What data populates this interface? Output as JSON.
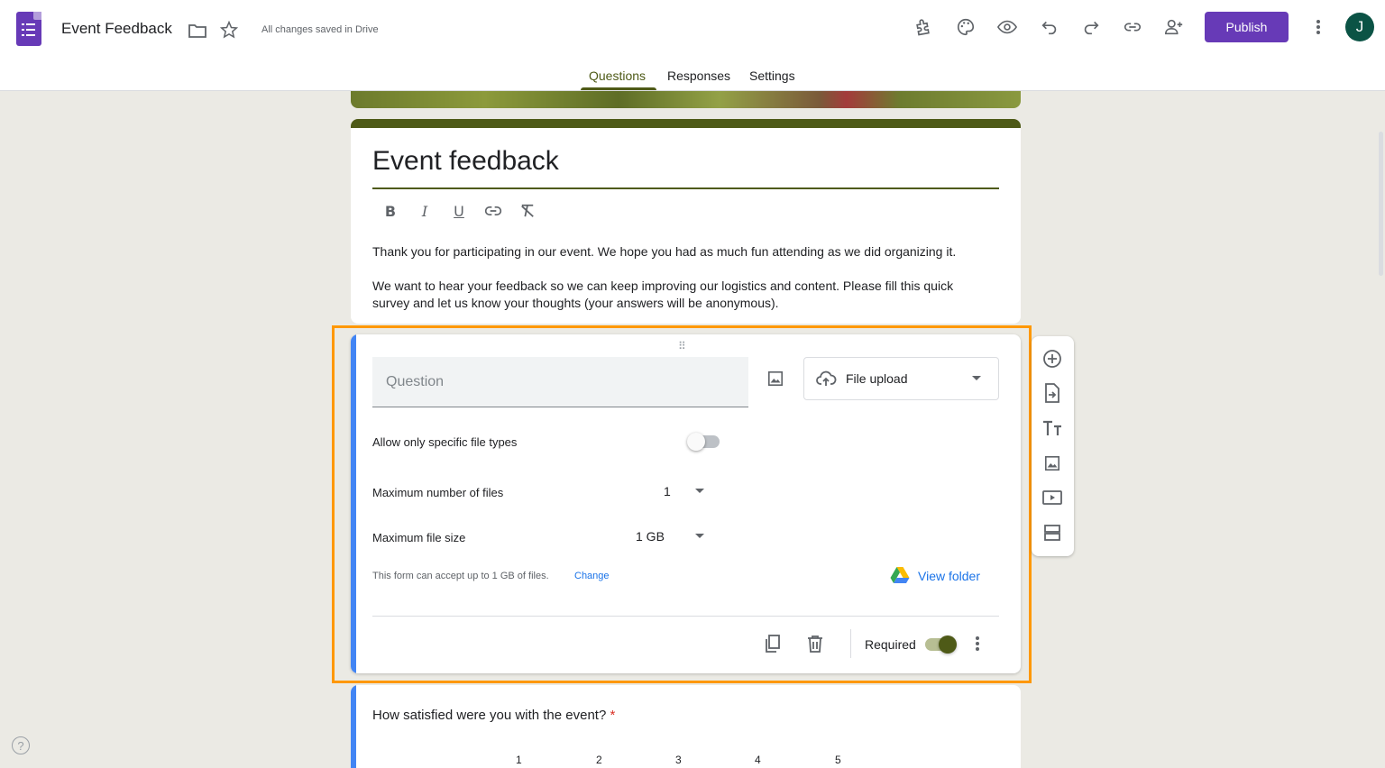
{
  "header": {
    "doc_title": "Event Feedback",
    "saved_status": "All changes saved in Drive",
    "publish_label": "Publish",
    "avatar_initial": "J",
    "icons": [
      "folder-icon",
      "star-icon",
      "addon-icon",
      "palette-icon",
      "preview-icon",
      "undo-icon",
      "redo-icon",
      "link-icon",
      "add-collaborator-icon",
      "more-vert-icon"
    ]
  },
  "tabs": [
    {
      "label": "Questions",
      "active": true
    },
    {
      "label": "Responses",
      "active": false
    },
    {
      "label": "Settings",
      "active": false
    }
  ],
  "form": {
    "title": "Event feedback",
    "description_1": "Thank you for participating in our event. We hope you had as much fun attending as we did organizing it.",
    "description_2": "We want to hear your feedback so we can keep improving our logistics and content. Please fill this quick survey and let us know your thoughts (your answers will be anonymous).",
    "format_tools": [
      "bold",
      "italic",
      "underline",
      "link",
      "clear-formatting"
    ]
  },
  "question_card": {
    "placeholder": "Question",
    "type_label": "File upload",
    "allow_specific_types_label": "Allow only specific file types",
    "allow_specific_types_on": false,
    "max_files_label": "Maximum number of files",
    "max_files_value": "1",
    "max_size_label": "Maximum file size",
    "max_size_value": "1 GB",
    "note": "This form can accept up to 1 GB of files.",
    "note_link": "Change",
    "view_folder": "View folder",
    "required_label": "Required",
    "required_on": true
  },
  "side_toolbar": [
    "add-question-icon",
    "import-questions-icon",
    "add-title-icon",
    "add-image-icon",
    "add-video-icon",
    "add-section-icon"
  ],
  "next_question": {
    "title": "How satisfied were you with the event?",
    "required_mark": "*",
    "scale": [
      "1",
      "2",
      "3",
      "4",
      "5"
    ]
  },
  "colors": {
    "theme": "#4e5a17",
    "brand": "#673ab7",
    "active_border": "#4285f4",
    "highlight": "#ff9800"
  }
}
